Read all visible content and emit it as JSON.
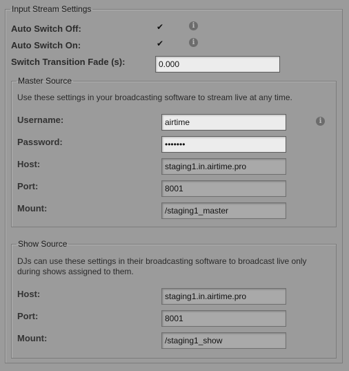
{
  "input_stream": {
    "legend": "Input Stream Settings",
    "auto_switch_off": {
      "label": "Auto Switch Off:",
      "checked": true
    },
    "auto_switch_on": {
      "label": "Auto Switch On:",
      "checked": true
    },
    "transition_fade": {
      "label": "Switch Transition Fade (s):",
      "value": "0.000"
    }
  },
  "master_source": {
    "legend": "Master Source",
    "hint": "Use these settings in your broadcasting software to stream live at any time.",
    "username": {
      "label": "Username:",
      "value": "airtime"
    },
    "password": {
      "label": "Password:",
      "value": "•••••••"
    },
    "host": {
      "label": "Host:",
      "value": "staging1.in.airtime.pro"
    },
    "port": {
      "label": "Port:",
      "value": "8001"
    },
    "mount": {
      "label": "Mount:",
      "value": "/staging1_master"
    }
  },
  "show_source": {
    "legend": "Show Source",
    "hint_line1": "DJs can use these settings in their broadcasting software to broadcast live only",
    "hint_line2": "during shows assigned to them.",
    "host": {
      "label": "Host:",
      "value": "staging1.in.airtime.pro"
    },
    "port": {
      "label": "Port:",
      "value": "8001"
    },
    "mount": {
      "label": "Mount:",
      "value": "/staging1_show"
    }
  },
  "icons": {
    "check": "checkmark-icon",
    "info": "info-icon"
  }
}
